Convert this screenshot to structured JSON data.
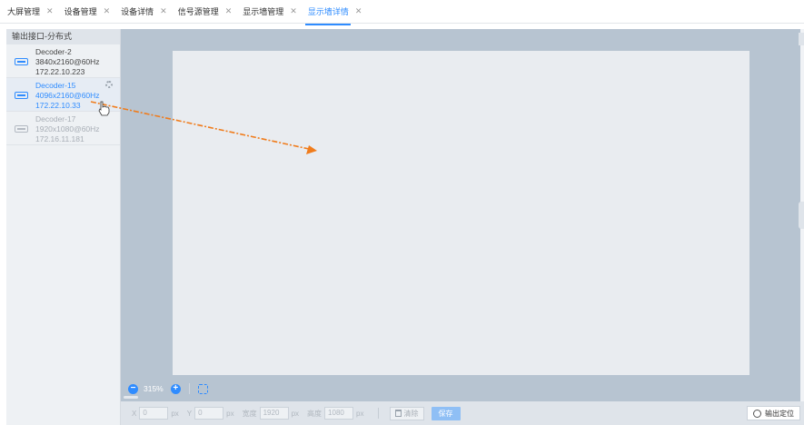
{
  "tabs": [
    {
      "label": "大屏管理",
      "close": "✕",
      "active": false
    },
    {
      "label": "设备管理",
      "close": "✕",
      "active": false
    },
    {
      "label": "设备详情",
      "close": "✕",
      "active": false
    },
    {
      "label": "信号源管理",
      "close": "✕",
      "active": false
    },
    {
      "label": "显示墙管理",
      "close": "✕",
      "active": false
    },
    {
      "label": "显示墙详情",
      "close": "✕",
      "active": true
    }
  ],
  "left_panel": {
    "title": "输出接口-分布式",
    "devices": [
      {
        "name": "Decoder-2",
        "resolution": "3840x2160@60Hz",
        "ip": "172.22.10.223",
        "state": "normal"
      },
      {
        "name": "Decoder-15",
        "resolution": "4096x2160@60Hz",
        "ip": "172.22.10.33",
        "state": "selected"
      },
      {
        "name": "Decoder-17",
        "resolution": "1920x1080@60Hz",
        "ip": "172.16.11.181",
        "state": "disabled"
      }
    ]
  },
  "zoom": {
    "minus": "−",
    "value": "315%",
    "plus": "+"
  },
  "bottom_bar": {
    "x_label": "X",
    "x_value": "0",
    "x_unit": "px",
    "y_label": "Y",
    "y_value": "0",
    "y_unit": "px",
    "w_label": "宽度",
    "w_value": "1920",
    "w_unit": "px",
    "h_label": "高度",
    "h_value": "1080",
    "h_unit": "px",
    "clear_label": "清除",
    "save_label": "保存",
    "locate_label": "输出定位"
  },
  "colors": {
    "accent": "#2f8cff",
    "canvas_bg": "#b7c4d1",
    "screen_bg": "#e9ecf0",
    "drag_arrow": "#f07c1c"
  },
  "icons": [
    "monitor-icon",
    "gear-icon",
    "hand-cursor-icon",
    "zoom-out-icon",
    "zoom-in-icon",
    "fit-screen-icon",
    "trash-icon",
    "crosshair-icon",
    "close-icon"
  ]
}
